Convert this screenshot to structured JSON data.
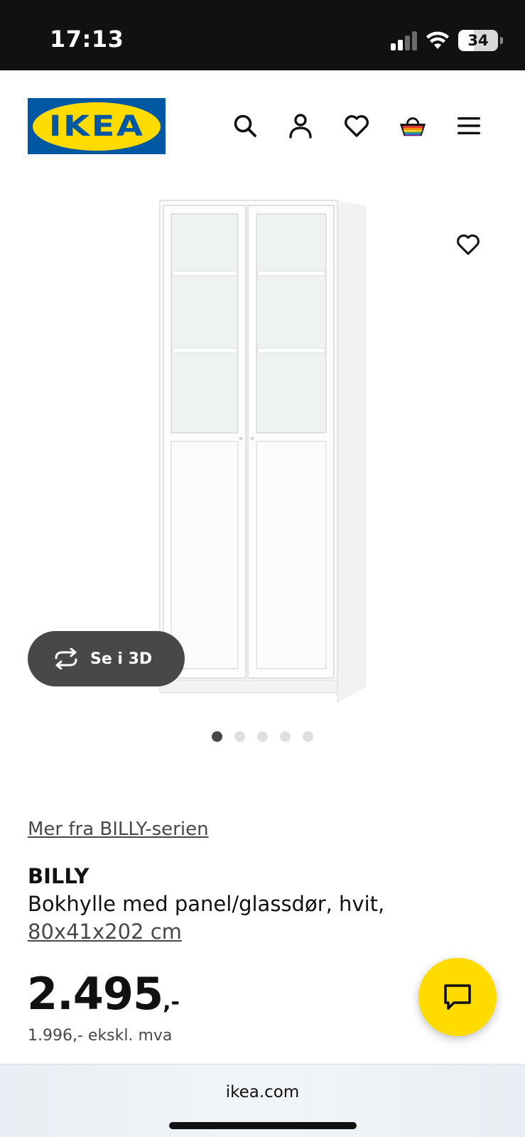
{
  "status_bar": {
    "time": "17:13",
    "battery": "34"
  },
  "header": {
    "logo_text": "IKEA",
    "icons": [
      "search-icon",
      "profile-icon",
      "heart-icon",
      "basket-icon",
      "menu-icon"
    ]
  },
  "gallery": {
    "view3d_label": "Se i 3D",
    "dots_total": 5,
    "active_index": 0
  },
  "product": {
    "series_link": "Mer fra BILLY-serien",
    "name": "BILLY",
    "description": "Bokhylle med panel/glassdør, hvit,",
    "size": "80x41x202 cm",
    "price_main": "2.495",
    "price_suffix": ",-",
    "price_ex_vat": "1.996,- ekskl. mva"
  },
  "browser": {
    "url": "ikea.com"
  },
  "colors": {
    "brand_blue": "#0058a3",
    "brand_yellow": "#ffdb00"
  }
}
